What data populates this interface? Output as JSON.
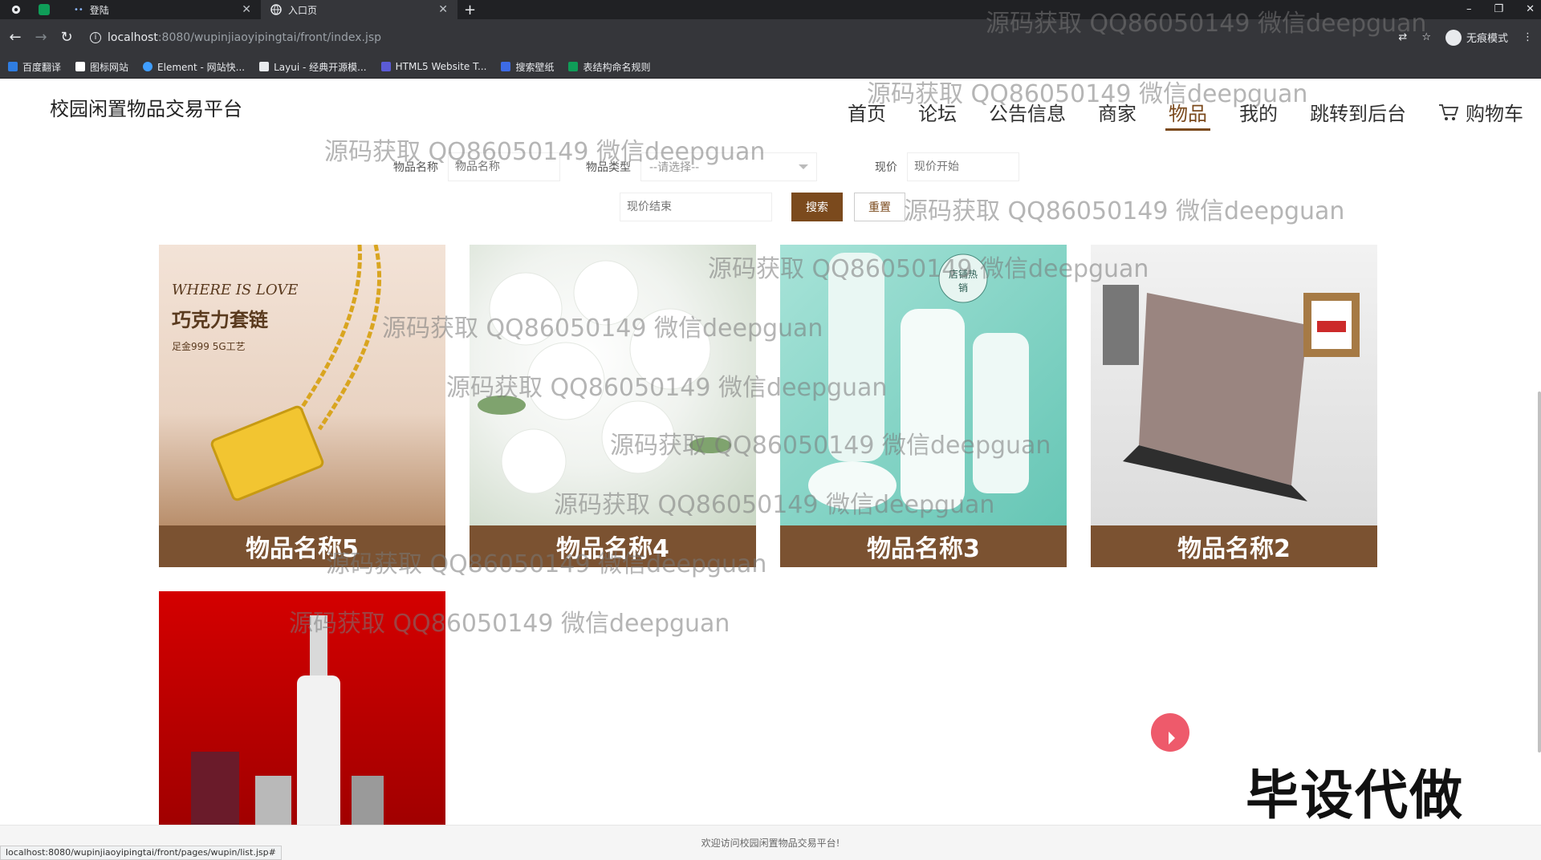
{
  "browser": {
    "tabs": [
      {
        "title": "登陆",
        "active": false
      },
      {
        "title": "入口页",
        "active": true
      }
    ],
    "new_tab": "+",
    "window_controls": {
      "minimize": "–",
      "restore": "❐",
      "close": "✕"
    },
    "url_host": "localhost",
    "url_path": ":8080/wupinjiaoyipingtai/front/index.jsp",
    "profile_label": "无痕模式",
    "bookmarks": [
      {
        "label": "百度翻译",
        "color": "#2f7de1"
      },
      {
        "label": "图标网站",
        "color": "#ffffff"
      },
      {
        "label": "Element - 网站快...",
        "color": "#409eff"
      },
      {
        "label": "Layui - 经典开源模...",
        "color": "#e8eaed"
      },
      {
        "label": "HTML5 Website T...",
        "color": "#5b5bd6"
      },
      {
        "label": "搜索壁纸",
        "color": "#3d6be5"
      },
      {
        "label": "表结构命名规则",
        "color": "#0f9d58"
      }
    ]
  },
  "site": {
    "title": "校园闲置物品交易平台",
    "nav": [
      {
        "label": "首页",
        "active": false
      },
      {
        "label": "论坛",
        "active": false
      },
      {
        "label": "公告信息",
        "active": false
      },
      {
        "label": "商家",
        "active": false
      },
      {
        "label": "物品",
        "active": true
      },
      {
        "label": "我的",
        "active": false
      },
      {
        "label": "跳转到后台",
        "active": false
      },
      {
        "label": "购物车",
        "active": false
      }
    ],
    "accent_color": "#7b4a1d"
  },
  "search": {
    "name_label": "物品名称",
    "name_placeholder": "物品名称",
    "type_label": "物品类型",
    "type_select": "--请选择--",
    "price_label": "现价",
    "price_start_placeholder": "现价开始",
    "price_end_placeholder": "现价结束",
    "search_button": "搜索",
    "reset_button": "重置"
  },
  "products": [
    {
      "name": "物品名称5",
      "image_icon": "necklace-image",
      "image_text_1": "WHERE IS LOVE",
      "image_text_2": "巧克力套链",
      "image_text_3": "足金999   5G工艺"
    },
    {
      "name": "物品名称4",
      "image_icon": "flowers-image"
    },
    {
      "name": "物品名称3",
      "image_icon": "skincare-bottles-image",
      "image_text_1": "店铺热销"
    },
    {
      "name": "物品名称2",
      "image_icon": "laptop-image"
    },
    {
      "name": "",
      "image_icon": "perfume-image"
    }
  ],
  "watermark_text": "源码获取 QQ86050149 微信deepguan",
  "overlay_badge": "毕设代做",
  "status_url": "localhost:8080/wupinjiaoyipingtai/front/pages/wupin/list.jsp#",
  "footer_text": "欢迎访问校园闲置物品交易平台!"
}
